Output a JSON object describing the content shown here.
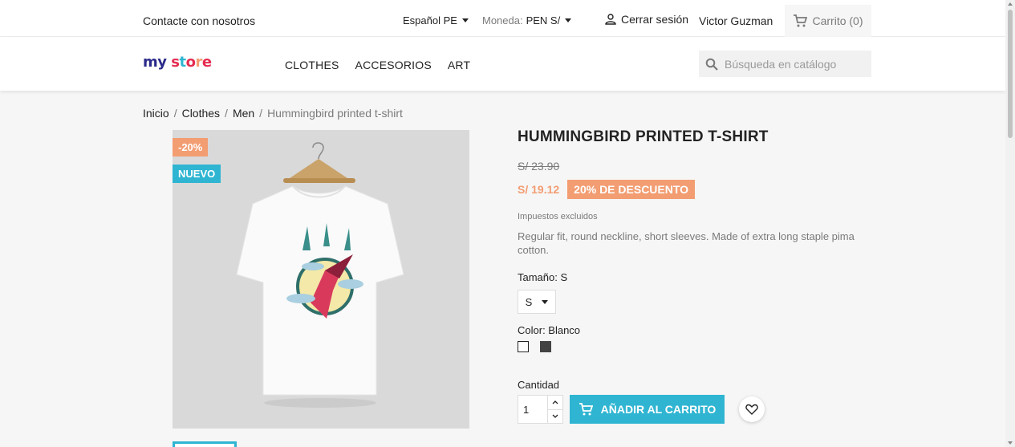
{
  "topbar": {
    "contact": "Contacte con nosotros",
    "language": "Español PE",
    "currency_label": "Moneda:",
    "currency_value": "PEN S/",
    "logout": "Cerrar sesión",
    "username": "Victor Guzman",
    "cart": "Carrito (0)"
  },
  "header": {
    "logo_my": "my",
    "logo_store": [
      "s",
      "t",
      "o",
      "r",
      "e"
    ],
    "nav": [
      "CLOTHES",
      "ACCESORIOS",
      "ART"
    ],
    "search_placeholder": "Búsqueda en catálogo"
  },
  "breadcrumb": {
    "items": [
      "Inicio",
      "Clothes",
      "Men"
    ],
    "current": "Hummingbird printed t-shirt",
    "separator": "/"
  },
  "product": {
    "flag_discount": "-20%",
    "flag_new": "NUEVO",
    "title": "HUMMINGBIRD PRINTED T-SHIRT",
    "regular_price": "S/ 23.90",
    "price": "S/ 19.12",
    "discount_badge": "20% DE DESCUENTO",
    "tax_label": "Impuestos excluidos",
    "description": "Regular fit, round neckline, short sleeves. Made of extra long staple pima cotton.",
    "size_label": "Tamaño: S",
    "size_value": "S",
    "color_label": "Color: Blanco",
    "quantity_label": "Cantidad",
    "quantity_value": "1",
    "add_to_cart": "AÑADIR AL CARRITO"
  },
  "colors": {
    "accent": "#2fb5d2",
    "discount": "#f39d72",
    "swatch_white": "#ffffff",
    "swatch_dark": "#434343"
  }
}
